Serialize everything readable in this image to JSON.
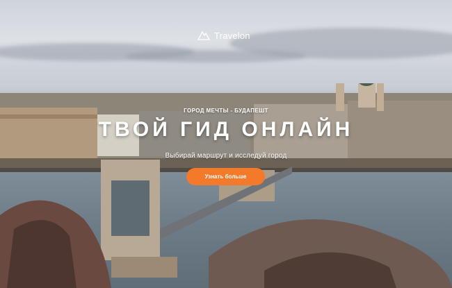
{
  "brand": {
    "name": "Travelon",
    "icon": "mountain-logo-icon"
  },
  "hero": {
    "kicker": "ГОРОД МЕЧТЫ - БУДАПЕШТ",
    "headline": "ТВОЙ ГИД ОНЛАЙН",
    "subtitle": "Выбирай маршрут и исследуй город",
    "cta_label": "Узнать больше"
  },
  "colors": {
    "accent": "#f27a2a",
    "text": "#ffffff"
  }
}
